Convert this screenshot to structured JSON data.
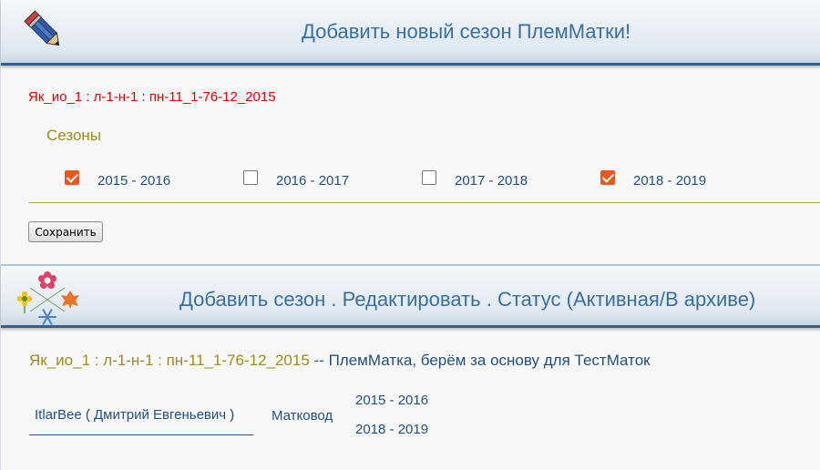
{
  "add_panel": {
    "title": "Добавить новый сезон ПлемМатки!",
    "queen_title": "Як_ио_1 : л-1-н-1 : пн-11_1-76-12_2015",
    "seasons_label": "Сезоны",
    "seasons": [
      {
        "label": "2015 - 2016",
        "checked": true
      },
      {
        "label": "2016 - 2017",
        "checked": false
      },
      {
        "label": "2017 - 2018",
        "checked": false
      },
      {
        "label": "2018 - 2019",
        "checked": true
      }
    ],
    "save_label": "Сохранить"
  },
  "season_panel": {
    "title": "Добавить сезон . Редактировать . Статус (Активная/В архиве)",
    "queen_name": "Як_ио_1 : л-1-н-1 : пн-11_1-76-12_2015",
    "separator": " -- ",
    "queen_desc": "ПлемМатка, берём за основу для ТестМаток",
    "breeder": "ItlarBee ( Дмитрий Евгеньевич )",
    "role": "Матковод",
    "active_seasons": [
      "2015 - 2016",
      "2018 - 2019"
    ]
  },
  "colors": {
    "accent_orange": "#e8581e",
    "link_blue": "#1f4f82",
    "header_blue": "#3a6f9f",
    "gold": "#a08a22",
    "error_red": "#dd0000"
  },
  "icons": {
    "header1": "pencil-icon",
    "header2": "seasons-icon"
  }
}
